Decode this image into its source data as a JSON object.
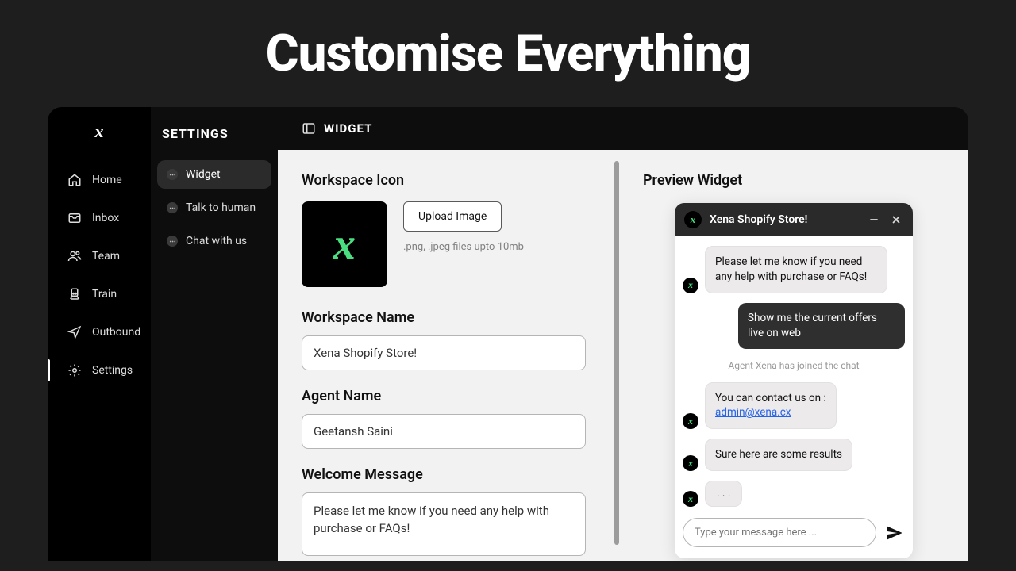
{
  "hero": {
    "title": "Customise Everything"
  },
  "sidebar": {
    "items": [
      {
        "label": "Home"
      },
      {
        "label": "Inbox"
      },
      {
        "label": "Team"
      },
      {
        "label": "Train"
      },
      {
        "label": "Outbound"
      },
      {
        "label": "Settings"
      }
    ]
  },
  "settings_panel": {
    "title": "SETTINGS",
    "items": [
      {
        "label": "Widget"
      },
      {
        "label": "Talk to human"
      },
      {
        "label": "Chat with us"
      }
    ]
  },
  "content_header": {
    "title": "WIDGET"
  },
  "form": {
    "workspace_icon_label": "Workspace Icon",
    "upload_label": "Upload Image",
    "upload_hint": ".png, .jpeg files upto 10mb",
    "workspace_name_label": "Workspace Name",
    "workspace_name_value": "Xena Shopify Store!",
    "agent_name_label": "Agent Name",
    "agent_name_value": "Geetansh Saini",
    "welcome_label": "Welcome Message",
    "welcome_value": "Please let me know if you need any help with purchase or FAQs!"
  },
  "preview": {
    "title": "Preview Widget",
    "widget_title": "Xena Shopify Store!",
    "messages": {
      "bot1": "Please let me know if you need any help with purchase or FAQs!",
      "user1": "Show me the current offers live on web",
      "system": "Agent Xena has joined the chat",
      "bot2_text": "You can contact us on :",
      "bot2_link": "admin@xena.cx",
      "bot3": "Sure here are some results",
      "bot4": ". . ."
    },
    "input_placeholder": "Type your message here ..."
  }
}
